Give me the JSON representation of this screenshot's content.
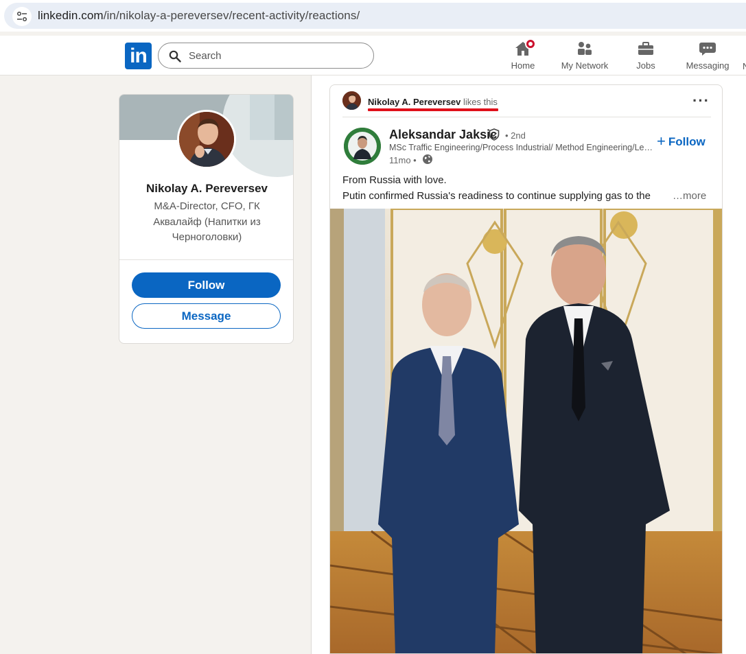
{
  "browser": {
    "url_host": "linkedin.com",
    "url_path": "/in/nikolay-a-pereversev/recent-activity/reactions/"
  },
  "header": {
    "logo_text": "in",
    "search_placeholder": "Search",
    "nav": [
      {
        "label": "Home",
        "icon": "home-icon"
      },
      {
        "label": "My Network",
        "icon": "network-icon"
      },
      {
        "label": "Jobs",
        "icon": "briefcase-icon"
      },
      {
        "label": "Messaging",
        "icon": "messaging-icon"
      }
    ],
    "nav_overflow": "N"
  },
  "profile": {
    "name": "Nikolay A. Pereversev",
    "headline": "M&A-Director, CFO, ГК Аквалайф (Напитки из Черноголовки)",
    "follow_label": "Follow",
    "message_label": "Message"
  },
  "post": {
    "liker_name": "Nikolay A. Pereversev",
    "liker_action": " likes this",
    "more_options": "···",
    "author": {
      "name": "Aleksandar Jaksic",
      "degree": "• 2nd",
      "headline": "MSc Traffic Engineering/Process Industrial/ Method Engineering/Lean/Kaizen",
      "time": "11mo •"
    },
    "follow_label": "Follow",
    "text_line1": "From Russia with love.",
    "text_line2": "Putin confirmed Russia's readiness to continue supplying gas to the",
    "see_more": "…more"
  },
  "colors": {
    "brand": "#0a66c2",
    "highlight_underline": "#e0101a",
    "notification_badge": "#cb112d",
    "page_bg": "#f4f2ee"
  }
}
